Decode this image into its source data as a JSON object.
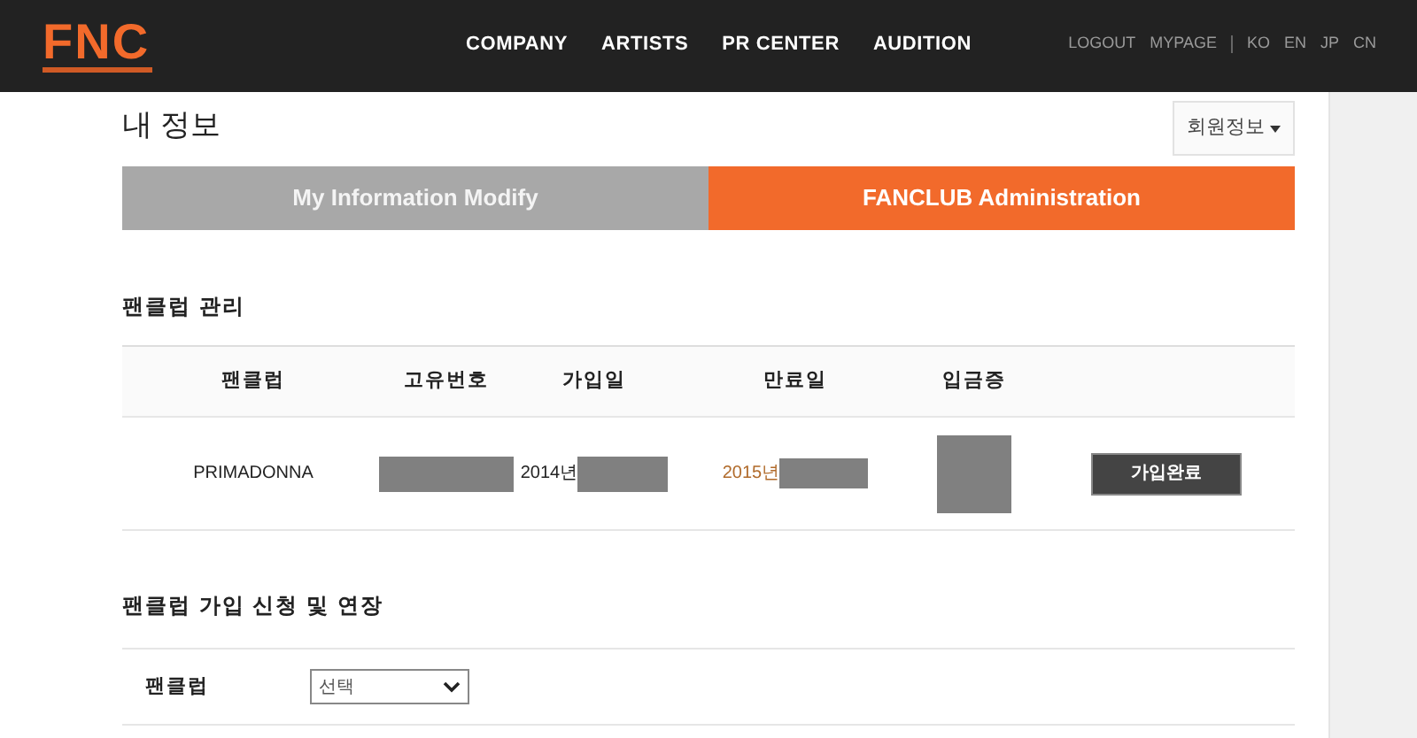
{
  "header": {
    "logo": "FNC",
    "nav": [
      "COMPANY",
      "ARTISTS",
      "PR CENTER",
      "AUDITION"
    ],
    "util_links": [
      "LOGOUT",
      "MYPAGE"
    ],
    "languages": [
      "KO",
      "EN",
      "JP",
      "CN"
    ]
  },
  "page_title": "내 정보",
  "member_menu": {
    "label": "회원정보"
  },
  "tabs": [
    {
      "label": "My Information Modify",
      "selected": false
    },
    {
      "label": "FANCLUB Administration",
      "selected": true
    }
  ],
  "fanclub_section": {
    "title": "팬클럽 관리",
    "columns": [
      "팬클럽",
      "고유번호",
      "가입일",
      "만료일",
      "입금증"
    ],
    "rows": [
      {
        "fanclub": "PRIMADONNA",
        "joined_year": "2014년",
        "expires_year": "2015년",
        "action": "가입완료"
      }
    ]
  },
  "apply_section": {
    "title": "팬클럽 가입 신청 및 연장",
    "field_label": "팬클럽",
    "select_value": "선택"
  }
}
